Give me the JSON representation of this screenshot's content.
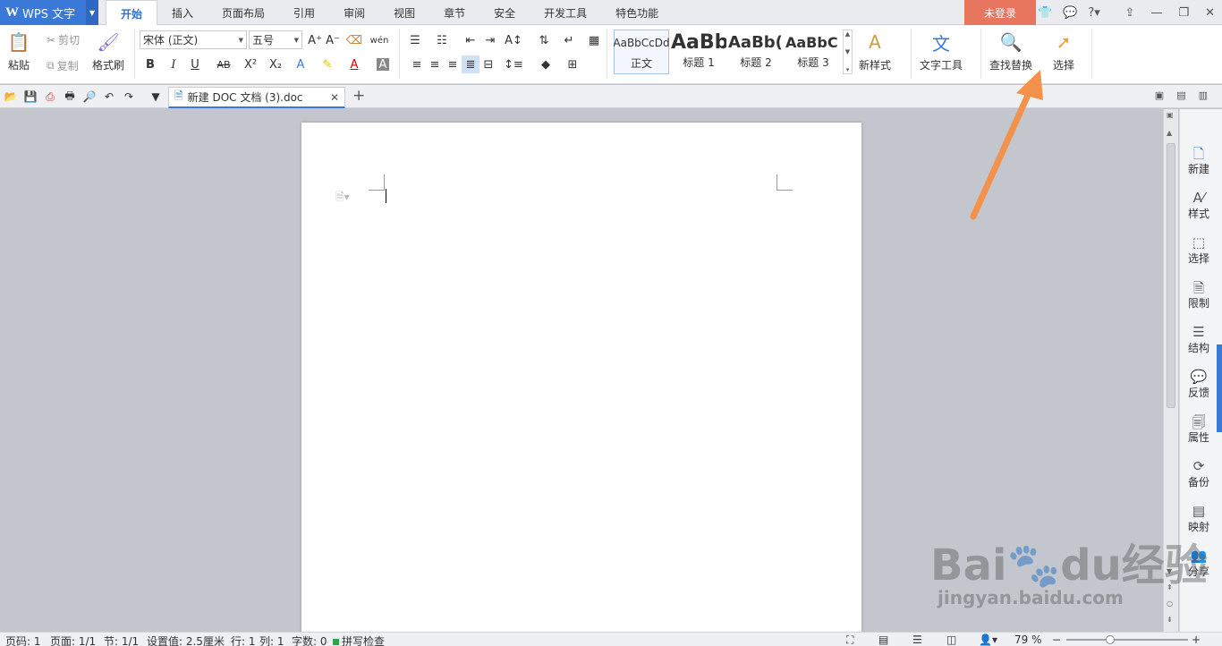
{
  "app": {
    "name": "WPS 文字"
  },
  "menu_tabs": [
    "开始",
    "插入",
    "页面布局",
    "引用",
    "审阅",
    "视图",
    "章节",
    "安全",
    "开发工具",
    "特色功能"
  ],
  "login_label": "未登录",
  "ribbon": {
    "paste": "粘贴",
    "cut": "剪切",
    "copy": "复制",
    "format_painter": "格式刷",
    "font_name": "宋体 (正文)",
    "font_size": "五号",
    "styles": [
      {
        "sample": "AaBbCcDd",
        "label": "正文"
      },
      {
        "sample": "AaBb",
        "label": "标题 1"
      },
      {
        "sample": "AaBb(",
        "label": "标题 2"
      },
      {
        "sample": "AaBbC",
        "label": "标题 3"
      }
    ],
    "new_style": "新样式",
    "text_tools": "文字工具",
    "find_replace": "查找替换",
    "select": "选择"
  },
  "doc_tab": {
    "title": "新建 DOC 文档 (3).doc"
  },
  "side_panel": [
    "新建",
    "样式",
    "选择",
    "限制",
    "结构",
    "反馈",
    "属性",
    "备份",
    "映射",
    "分享"
  ],
  "status": {
    "page_code": "页码: 1",
    "page": "页面: 1/1",
    "section": "节: 1/1",
    "setting": "设置值: 2.5厘米",
    "row": "行: 1",
    "col": "列: 1",
    "chars": "字数: 0",
    "spell": "拼写检查",
    "zoom": "79 %"
  },
  "watermark": {
    "brand": "Bai",
    "brand2": "du",
    "cn": "经验",
    "url": "jingyan.baidu.com"
  },
  "colors": {
    "accent": "#3b79d8",
    "login": "#e8765f",
    "arrow": "#f4914a"
  }
}
